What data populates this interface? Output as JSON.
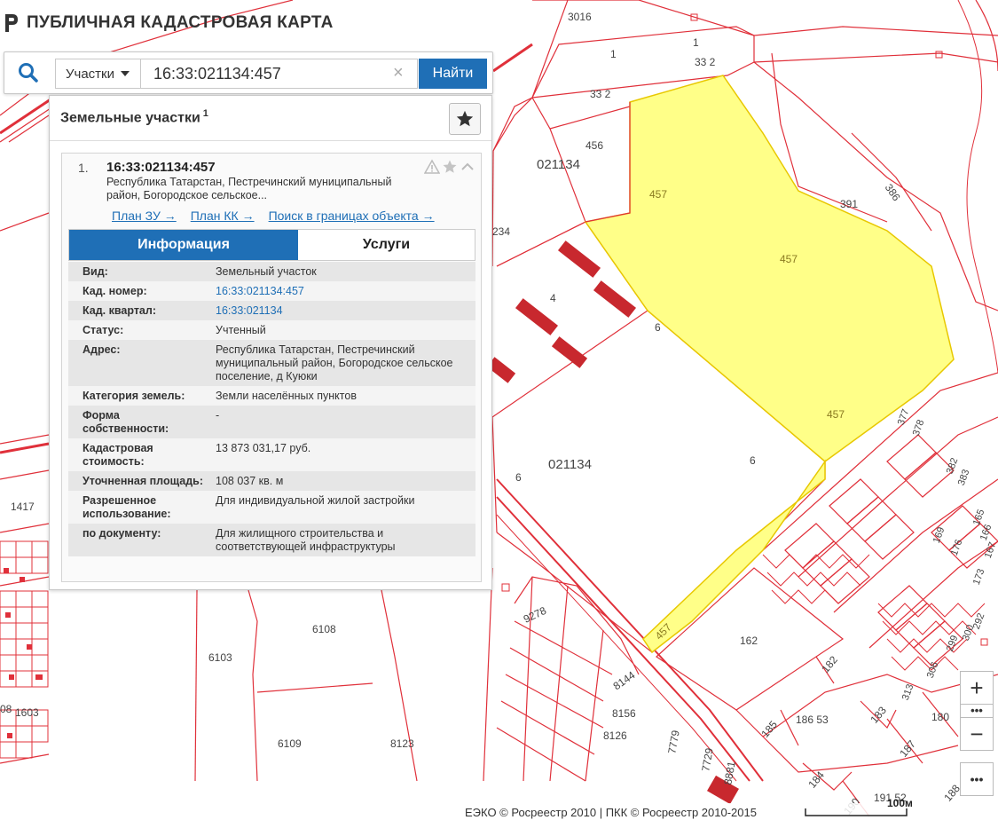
{
  "app": {
    "title": "ПУБЛИЧНАЯ КАДАСТРОВАЯ КАРТА"
  },
  "search": {
    "type_label": "Участки",
    "query_value": "16:33:021134:457",
    "clear_glyph": "×",
    "find_label": "Найти"
  },
  "results": {
    "title": "Земельные участки",
    "count": "1",
    "item": {
      "index": "1.",
      "number": "16:33:021134:457",
      "address_short": "Республика Татарстан, Пестречинский муниципальный район, Богородское сельское...",
      "links": {
        "plan_zu": "План ЗУ →",
        "plan_kk": "План КК →",
        "search_in_bounds": "Поиск в границах объекта →"
      },
      "tabs": {
        "info": "Информация",
        "services": "Услуги"
      },
      "fields": [
        {
          "key": "Вид:",
          "value": "Земельный участок",
          "link": false
        },
        {
          "key": "Кад. номер:",
          "value": "16:33:021134:457",
          "link": true
        },
        {
          "key": "Кад. квартал:",
          "value": "16:33:021134",
          "link": true
        },
        {
          "key": "Статус:",
          "value": "Учтенный",
          "link": false
        },
        {
          "key": "Адрес:",
          "value": "Республика Татарстан, Пестречинский муниципальный район, Богородское сельское поселение, д Куюки",
          "link": false
        },
        {
          "key": "Категория земель:",
          "value": "Земли населённых пунктов",
          "link": false
        },
        {
          "key": "Форма собственности:",
          "value": "-",
          "link": false
        },
        {
          "key": "Кадастровая стоимость:",
          "value": "13 873 031,17 руб.",
          "link": false
        },
        {
          "key": "Уточненная площадь:",
          "value": "108 037 кв. м",
          "link": false
        },
        {
          "key": "Разрешенное использование:",
          "value": "Для индивидуальной жилой застройки",
          "link": false
        },
        {
          "key": "по документу:",
          "value": "Для жилищного строительства и соответствующей инфраструктуры",
          "link": false
        }
      ]
    }
  },
  "map": {
    "labels": {
      "q1": "021134",
      "q2": "021134",
      "p3016": "3016",
      "p1a": "1",
      "p1b": "1",
      "p332a": "33 2",
      "p332b": "33 2",
      "p456": "456",
      "p457a": "457",
      "p457b": "457",
      "p457c": "457",
      "p457d": "457",
      "p391": "391",
      "p386": "386",
      "p234": "234",
      "p4": "4",
      "p6a": "6",
      "p6b": "6",
      "p6c": "6",
      "p1417": "1417",
      "p6103": "6103",
      "p6108": "6108",
      "p6109": "6109",
      "p8123": "8123",
      "p1603": "1603",
      "p08": "08",
      "p162": "162",
      "p182": "182",
      "p183": "183",
      "p185": "185",
      "p18653": "186 53",
      "p187": "187",
      "p184": "184",
      "p180": "180",
      "p19152": "191 52",
      "p190": "190",
      "p188": "188",
      "p9278": "9278",
      "p8144": "8144",
      "p8156": "8156",
      "p8126": "8126",
      "p7779": "7779",
      "p7729": "7729",
      "p8881": "8881",
      "p377": "377",
      "p378": "378",
      "p382": "382",
      "p383": "383",
      "p165": "165",
      "p166": "166",
      "p167": "167",
      "p169": "169",
      "p176": "176",
      "p173": "173",
      "p292": "292",
      "p299": "299",
      "p300": "300",
      "p306": "306",
      "p313": "313"
    },
    "colors": {
      "boundary": "#e0303a",
      "selected_fill": "#ffff88",
      "selected_stroke": "#e8c800",
      "buildings": "#c8282e"
    }
  },
  "zoom": {
    "plus": "+",
    "minus": "−",
    "more": "•••"
  },
  "footer": {
    "copyright": "ЕЭКО © Росреестр 2010 | ПКК © Росреестр 2010-2015",
    "scale": "100м"
  }
}
